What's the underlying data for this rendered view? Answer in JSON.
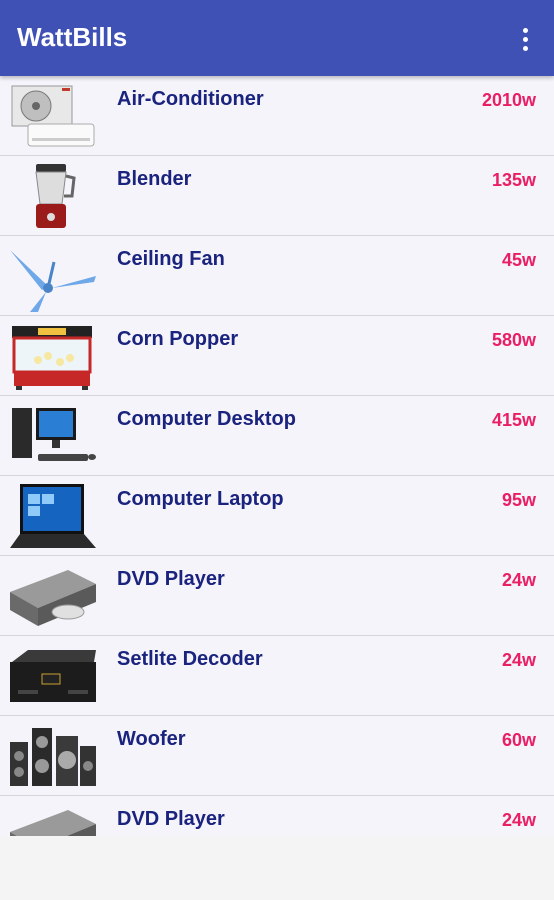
{
  "app": {
    "title": "WattBills",
    "menu_icon": "more-vert-icon"
  },
  "appliances": [
    {
      "name": "Air-Conditioner",
      "watts": "2010w",
      "icon": "air-conditioner-icon"
    },
    {
      "name": "Blender",
      "watts": "135w",
      "icon": "blender-icon"
    },
    {
      "name": "Ceiling Fan",
      "watts": "45w",
      "icon": "ceiling-fan-icon"
    },
    {
      "name": "Corn Popper",
      "watts": "580w",
      "icon": "corn-popper-icon"
    },
    {
      "name": "Computer Desktop",
      "watts": "415w",
      "icon": "desktop-computer-icon"
    },
    {
      "name": "Computer Laptop",
      "watts": "95w",
      "icon": "laptop-icon"
    },
    {
      "name": "DVD Player",
      "watts": "24w",
      "icon": "dvd-player-icon"
    },
    {
      "name": "Setlite Decoder",
      "watts": "24w",
      "icon": "decoder-icon"
    },
    {
      "name": "Woofer",
      "watts": "60w",
      "icon": "woofer-icon"
    },
    {
      "name": "DVD Player",
      "watts": "24w",
      "icon": "dvd-player-icon"
    }
  ],
  "colors": {
    "appbar": "#3F51B5",
    "name_text": "#1A237E",
    "watts_text": "#E91E63"
  }
}
